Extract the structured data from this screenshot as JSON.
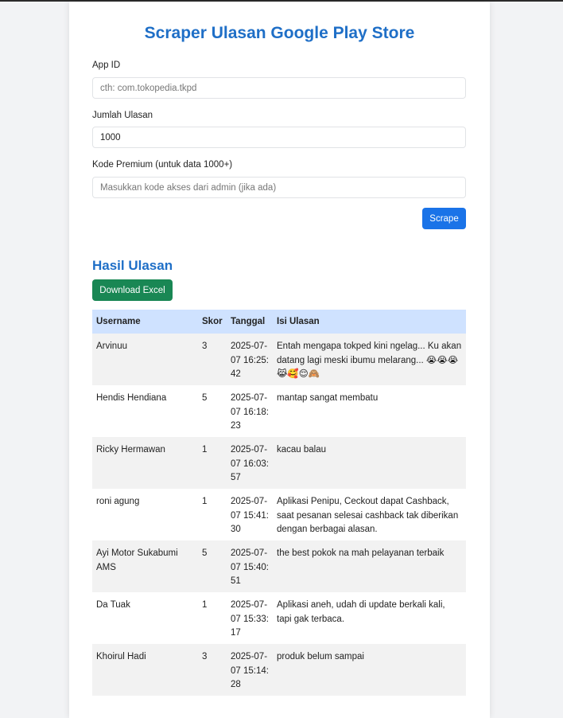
{
  "page": {
    "title": "Scraper Ulasan Google Play Store"
  },
  "form": {
    "app_id_label": "App ID",
    "app_id_value": "",
    "app_id_placeholder": "cth: com.tokopedia.tkpd",
    "count_label": "Jumlah Ulasan",
    "count_value": "1000",
    "premium_label": "Kode Premium (untuk data 1000+)",
    "premium_value": "",
    "premium_placeholder": "Masukkan kode akses dari admin (jika ada)",
    "scrape_label": "Scrape"
  },
  "results": {
    "title": "Hasil Ulasan",
    "download_label": "Download Excel",
    "headers": [
      "Username",
      "Skor",
      "Tanggal",
      "Isi Ulasan"
    ],
    "rows": [
      {
        "username": "Arvinuu",
        "skor": "3",
        "date": "2025-07-07",
        "time": "16:25:42",
        "text": "Entah mengapa tokped kini ngelag... Ku akan datang lagi meski ibumu melarang... 😭😭😭😹🥰😌🙈"
      },
      {
        "username": "Hendis Hendiana",
        "skor": "5",
        "date": "2025-07-07",
        "time": "16:18:23",
        "text": "mantap sangat membatu"
      },
      {
        "username": "Ricky Hermawan",
        "skor": "1",
        "date": "2025-07-07",
        "time": "16:03:57",
        "text": "kacau balau"
      },
      {
        "username": "roni agung",
        "skor": "1",
        "date": "2025-07-07",
        "time": "15:41:30",
        "text": "Aplikasi Penipu, Ceckout dapat Cashback, saat pesanan selesai cashback tak diberikan dengan berbagai alasan."
      },
      {
        "username": "Ayi Motor Sukabumi AMS",
        "skor": "5",
        "date": "2025-07-07",
        "time": "15:40:51",
        "text": "the best pokok na mah pelayanan terbaik"
      },
      {
        "username": "Da Tuak",
        "skor": "1",
        "date": "2025-07-07",
        "time": "15:33:17",
        "text": "Aplikasi aneh, udah di update berkali kali, tapi gak terbaca."
      },
      {
        "username": "Khoirul Hadi",
        "skor": "3",
        "date": "2025-07-07",
        "time": "15:14:28",
        "text": "produk belum sampai"
      }
    ]
  }
}
